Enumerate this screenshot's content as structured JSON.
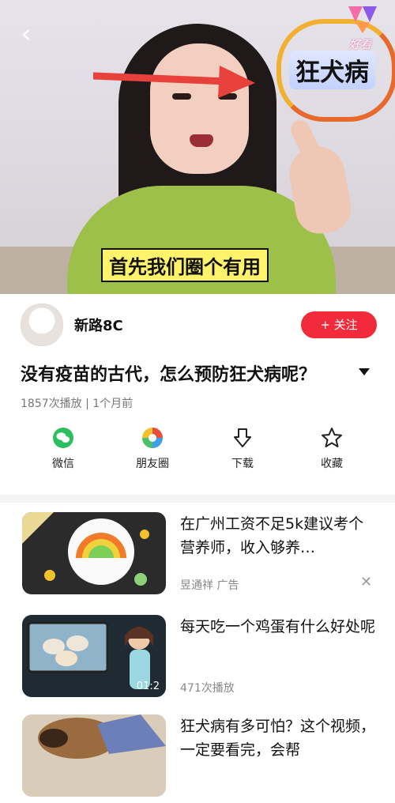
{
  "video": {
    "badge_text": "狂犬病",
    "brand_text": "好看",
    "subtitle": "首先我们圈个有用",
    "back_glyph": "‹"
  },
  "author": {
    "name": "新路8C",
    "follow_label": "+ 关注"
  },
  "title": {
    "text": "没有疫苗的古代，怎么预防狂犬病呢？",
    "meta": "1857次播放 | 1个月前"
  },
  "actions": [
    {
      "label": "微信",
      "icon": "wechat-icon"
    },
    {
      "label": "朋友圈",
      "icon": "moments-icon"
    },
    {
      "label": "下载",
      "icon": "download-icon"
    },
    {
      "label": "收藏",
      "icon": "favorite-icon"
    }
  ],
  "recommendations": [
    {
      "title": "在广州工资不足5k建议考个营养师，收入够养…",
      "meta": "昱通祥  广告",
      "close": "✕"
    },
    {
      "title": "每天吃一个鸡蛋有什么好处呢",
      "meta": "471次播放",
      "duration": "01:2"
    },
    {
      "title": "狂犬病有多可怕？这个视频，一定要看完，会帮",
      "meta": ""
    }
  ],
  "colors": {
    "accent": "#f12b3c",
    "subtitle_bg": "#fff36b",
    "shirt": "#9cc04a"
  }
}
